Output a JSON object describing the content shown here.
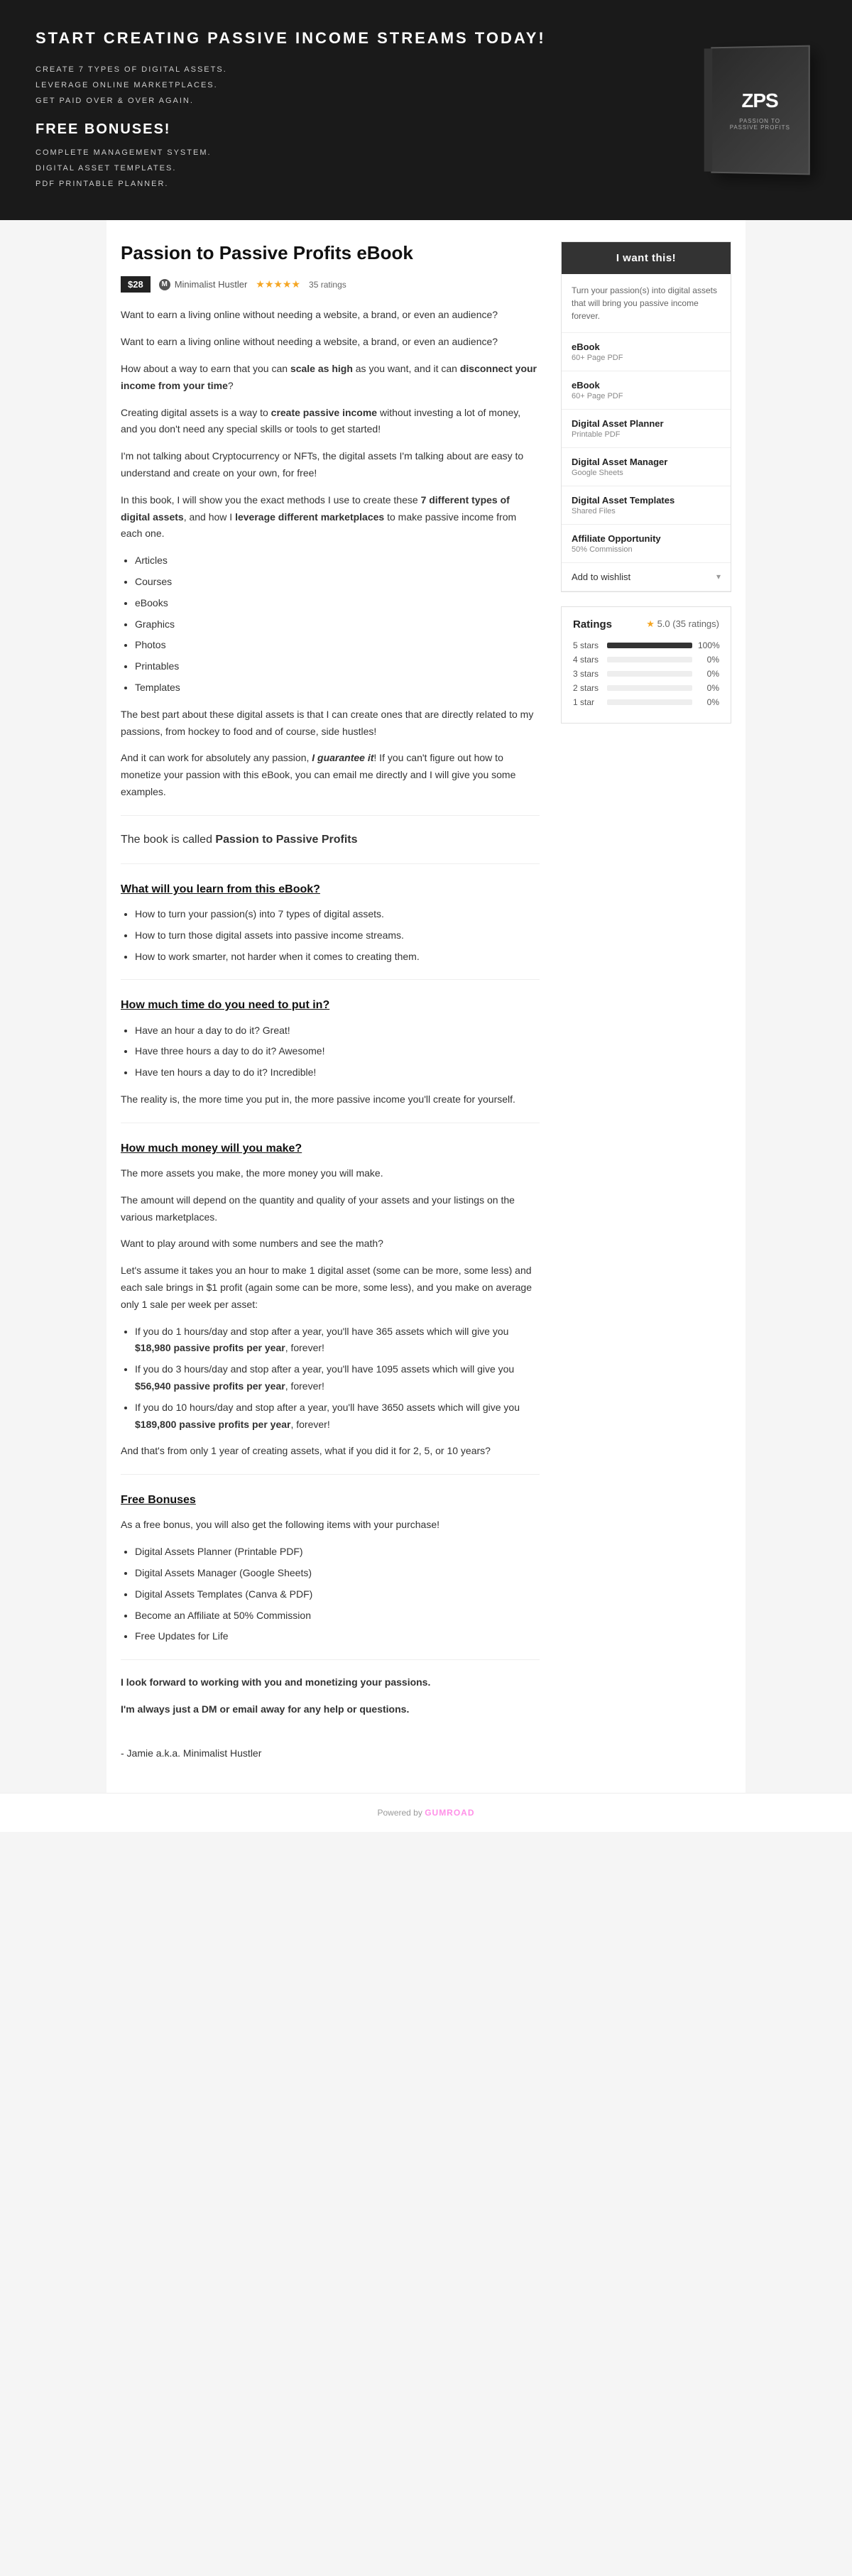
{
  "hero": {
    "title": "START CREATING PASSIVE INCOME STREAMS TODAY!",
    "points": [
      "CREATE 7 TYPES OF DIGITAL ASSETS.",
      "LEVERAGE ONLINE MARKETPLACES.",
      "GET PAID OVER & OVER AGAIN."
    ],
    "bonus_title": "FREE BONUSES!",
    "bonus_points": [
      "COMPLETE MANAGEMENT SYSTEM.",
      "DIGITAL ASSET TEMPLATES.",
      "PDF PRINTABLE PLANNER."
    ],
    "book_logo": "ZPS",
    "book_subtitle": "PASSION TO\nPASSIVE PROFITS"
  },
  "product": {
    "title": "Passion to Passive Profits eBook",
    "price": "$28",
    "seller": "Minimalist Hustler",
    "ratings_count": "35 ratings",
    "stars": "★★★★★",
    "buy_label": "I want this!",
    "buy_description": "Turn your passion(s) into digital assets that will bring you passive income forever.",
    "wishlist_label": "Add to wishlist",
    "items": [
      {
        "name": "eBook",
        "type": "60+ Page PDF",
        "id": "ebook-forever"
      },
      {
        "name": "eBook",
        "type": "60+ Page PDF",
        "id": "ebook-2"
      },
      {
        "name": "Digital Asset Planner",
        "type": "Printable PDF",
        "id": "planner"
      },
      {
        "name": "Digital Asset Manager",
        "type": "Google Sheets",
        "id": "manager"
      },
      {
        "name": "Digital Asset Templates",
        "type": "Shared Files",
        "id": "templates"
      },
      {
        "name": "Affiliate Opportunity",
        "type": "50% Commission",
        "id": "affiliate"
      }
    ]
  },
  "ratings": {
    "title": "Ratings",
    "score": "5.0 (35 ratings)",
    "rows": [
      {
        "label": "5 stars",
        "pct": "100%",
        "fill": 100
      },
      {
        "label": "4 stars",
        "pct": "0%",
        "fill": 0
      },
      {
        "label": "3 stars",
        "pct": "0%",
        "fill": 0
      },
      {
        "label": "2 stars",
        "pct": "0%",
        "fill": 0
      },
      {
        "label": "1 star",
        "pct": "0%",
        "fill": 0
      }
    ]
  },
  "body": {
    "intro_1": "Want to earn a living online without needing a website, a brand, or even an audience?",
    "intro_2": "Want to earn a living online without needing a website, a brand, or even an audience?",
    "intro_3_pre": "How about a way to earn that you can ",
    "intro_3_bold1": "scale as high",
    "intro_3_mid": " as you want, and it can ",
    "intro_3_bold2": "disconnect your income from your time",
    "intro_3_end": "?",
    "intro_4_pre": "Creating digital assets is a way to ",
    "intro_4_bold": "create passive income",
    "intro_4_end": " without investing a lot of money, and you don't need any special skills or tools to get started!",
    "intro_5": "I'm not talking about Cryptocurrency or NFTs, the digital assets I'm talking about are easy to understand and create on your own, for free!",
    "intro_6_pre": "In this book, I will show you the exact methods I use to create these ",
    "intro_6_bold1": "7 different types of digital assets",
    "intro_6_mid": ", and how I ",
    "intro_6_bold2": "leverage different marketplaces",
    "intro_6_end": " to make passive income from each one.",
    "asset_types": [
      "Articles",
      "Courses",
      "eBooks",
      "Graphics",
      "Photos",
      "Printables",
      "Templates"
    ],
    "closing_1": "The best part about these digital assets is that I can create ones that are directly related to my passions, from hockey to food and of course, side hustles!",
    "closing_2_pre": "And it can work for absolutely any passion, ",
    "closing_2_bold": "I guarantee it",
    "closing_2_end": "! If you can't figure out how to monetize your passion with this eBook, you can email me directly and I will give you some examples.",
    "book_title": "The book is called ",
    "book_name": "Passion to Passive Profits",
    "section1_title": "What will you learn from this eBook?",
    "learn_points": [
      "How to turn your passion(s) into 7 types of digital assets.",
      "How to turn those digital assets into passive income streams.",
      "How to work smarter, not harder when it comes to creating them."
    ],
    "section2_title": "How much time do you need to put in?",
    "time_points": [
      "Have an hour a day to do it? Great!",
      "Have three hours a day to do it? Awesome!",
      "Have ten hours a day to do it? Incredible!"
    ],
    "time_closing": "The reality is, the more time you put in, the more passive income you'll create for yourself.",
    "section3_title": "How much money will you make?",
    "money_1": "The more assets you make, the more money you will make.",
    "money_2": "The amount will depend on the quantity and quality of your assets and your listings on the various marketplaces.",
    "money_3": "Want to play around with some numbers and see the math?",
    "money_4": "Let's assume it takes you an hour to make 1 digital asset (some can be more, some less) and each sale brings in $1 profit (again some can be more, some less), and you make on average only 1 sale per week per asset:",
    "money_points": [
      {
        "pre": "If you do 1 hours/day and stop after a year, you'll have 365 assets which will give you ",
        "bold": "$18,980 passive profits per year",
        "end": ", forever!"
      },
      {
        "pre": "If you do 3 hours/day and stop after a year, you'll have 1095 assets which will give you ",
        "bold": "$56,940 passive profits per year",
        "end": ", forever!"
      },
      {
        "pre": "If you do 10 hours/day and stop after a year, you'll have 3650 assets which will give you ",
        "bold": "$189,800 passive profits per year",
        "end": ", forever!"
      }
    ],
    "money_closing": "And that's from only 1 year of creating assets, what if you did it for 2, 5, or 10 years?",
    "section4_title": "Free Bonuses",
    "bonus_1": "As a free bonus, you will also get the following items with your purchase!",
    "bonus_points": [
      "Digital Assets Planner (Printable PDF)",
      "Digital Assets Manager (Google Sheets)",
      "Digital Assets Templates (Canva & PDF)",
      "Become an Affiliate at 50% Commission",
      "Free Updates for Life"
    ],
    "sign_off_1": "I look forward to working with you and monetizing your passions.",
    "sign_off_2": "I'm always just a DM or email away for any help or questions.",
    "sign_off_3": "- Jamie a.k.a. Minimalist Hustler"
  },
  "footer": {
    "powered": "Powered by",
    "brand": "GUMROAD"
  }
}
